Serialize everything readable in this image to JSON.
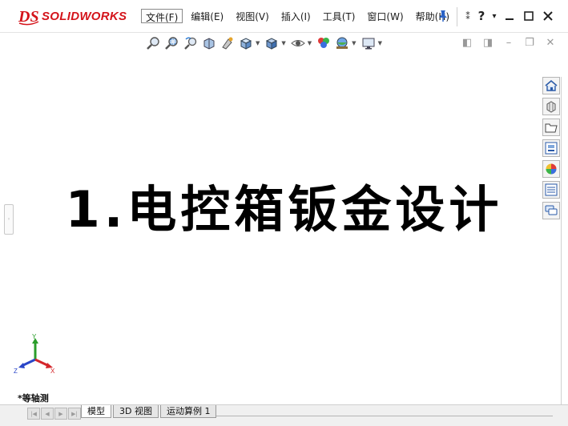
{
  "app": {
    "logo_ds": "DS",
    "logo_name": "SOLIDWORKS"
  },
  "menu": {
    "items": [
      "文件(F)",
      "编辑(E)",
      "视图(V)",
      "插入(I)",
      "工具(T)",
      "窗口(W)",
      "帮助(H)"
    ]
  },
  "window": {
    "options_glyph": "⁑",
    "help_glyph": "?",
    "dropdown_glyph": "▾",
    "minimize_glyph": "▁",
    "maximize_glyph": "☐",
    "close_glyph": "✕"
  },
  "doc_window": {
    "tile_left_glyph": "◧",
    "tile_right_glyph": "◨",
    "minimize_glyph": "–",
    "restore_glyph": "❐",
    "close_glyph": "✕"
  },
  "toolbar": {
    "icons": [
      "zoom-to-fit-icon",
      "zoom-to-area-icon",
      "previous-view-icon",
      "section-view-icon",
      "dynamic-annotation-icon",
      "view-orientation-icon",
      "display-style-icon",
      "hide-show-icon",
      "edit-appearance-icon",
      "apply-scene-icon",
      "view-settings-icon"
    ]
  },
  "taskpane": {
    "icons": [
      "home-icon",
      "design-library-icon",
      "file-explorer-icon",
      "view-palette-icon",
      "appearances-icon",
      "custom-properties-icon",
      "forum-icon"
    ]
  },
  "main": {
    "title": "1.电控箱钣金设计"
  },
  "triad": {
    "y": "Y",
    "z": "Z",
    "x": "X"
  },
  "view": {
    "label": "*等轴测"
  },
  "tabs": {
    "items": [
      "模型",
      "3D 视图",
      "运动算例 1"
    ],
    "active_index": 0
  },
  "colors": {
    "brand_red": "#d4141b",
    "axis_y": "#2a9d2a",
    "axis_z": "#2a46c8",
    "axis_x": "#d4262b"
  }
}
